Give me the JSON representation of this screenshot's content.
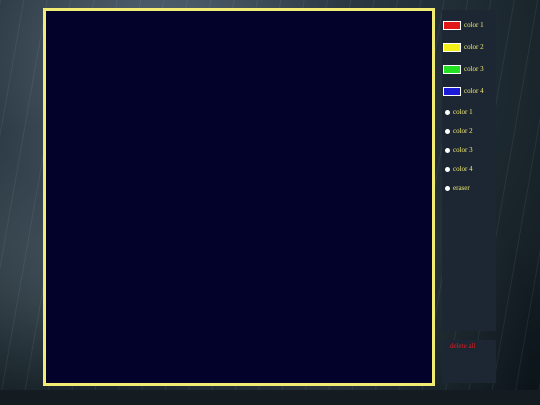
{
  "colors": {
    "canvas_border": "#f3ec73",
    "canvas_bg": "#02022a",
    "panel_bg": "#1d2734",
    "label_text": "#f3ec73",
    "delete_text": "#d62020"
  },
  "swatches": [
    {
      "label": "color 1",
      "color": "#e01818"
    },
    {
      "label": "color 2",
      "color": "#f4ef18"
    },
    {
      "label": "color 3",
      "color": "#22e022"
    },
    {
      "label": "color 4",
      "color": "#1c1cd8"
    }
  ],
  "radios": [
    {
      "label": "color 1"
    },
    {
      "label": "color 2"
    },
    {
      "label": "color 3"
    },
    {
      "label": "color 4"
    },
    {
      "label": "eraser"
    }
  ],
  "actions": {
    "delete_all": "delete all"
  }
}
